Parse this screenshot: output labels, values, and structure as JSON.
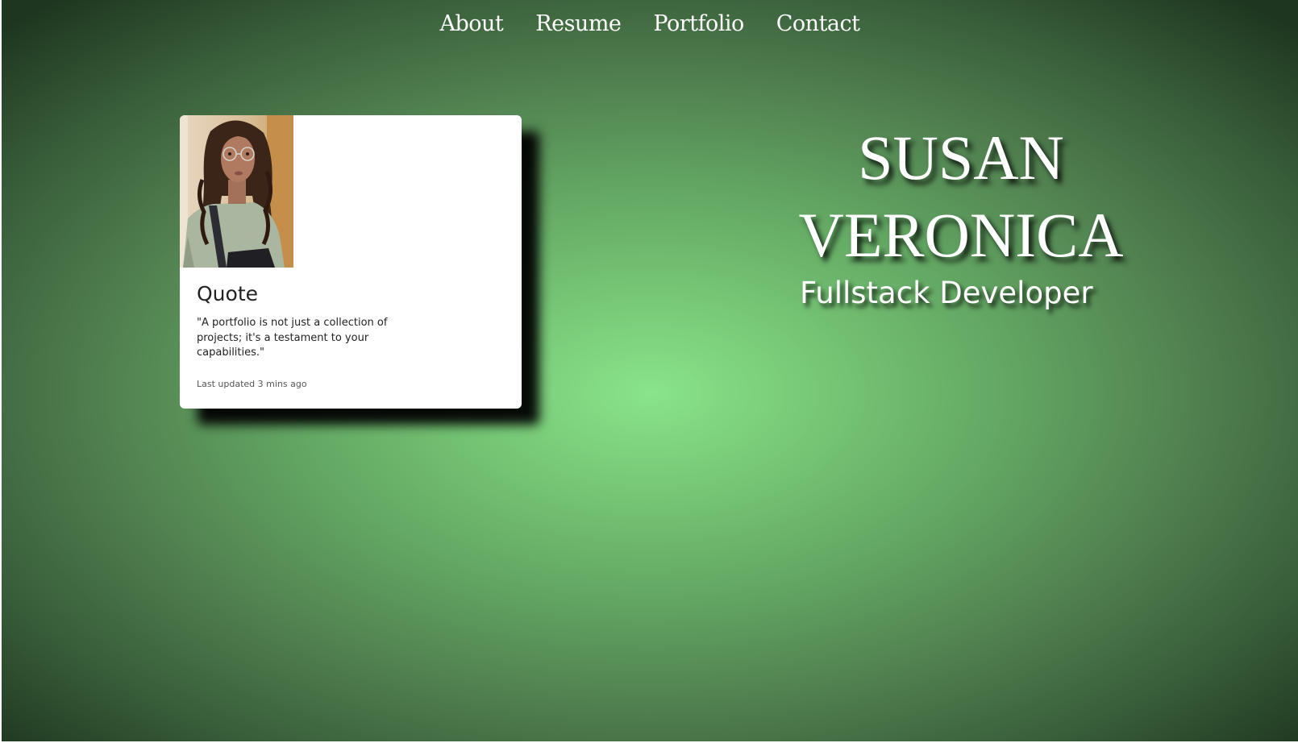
{
  "nav": {
    "items": [
      {
        "label": "About"
      },
      {
        "label": "Resume"
      },
      {
        "label": "Portfolio"
      },
      {
        "label": "Contact"
      }
    ]
  },
  "card": {
    "title": "Quote",
    "text": "\"A portfolio is not just a collection of projects; it's a testament to your capabilities.\"",
    "updated": "Last updated 3 mins ago"
  },
  "hero": {
    "name_line1": "SUSAN",
    "name_line2": "VERONICA",
    "role": "Fullstack Developer"
  },
  "colors": {
    "background_center": "#89e48a",
    "background_edge": "#1e3620",
    "card_background": "#ffffff",
    "text_light": "#ffffff"
  }
}
